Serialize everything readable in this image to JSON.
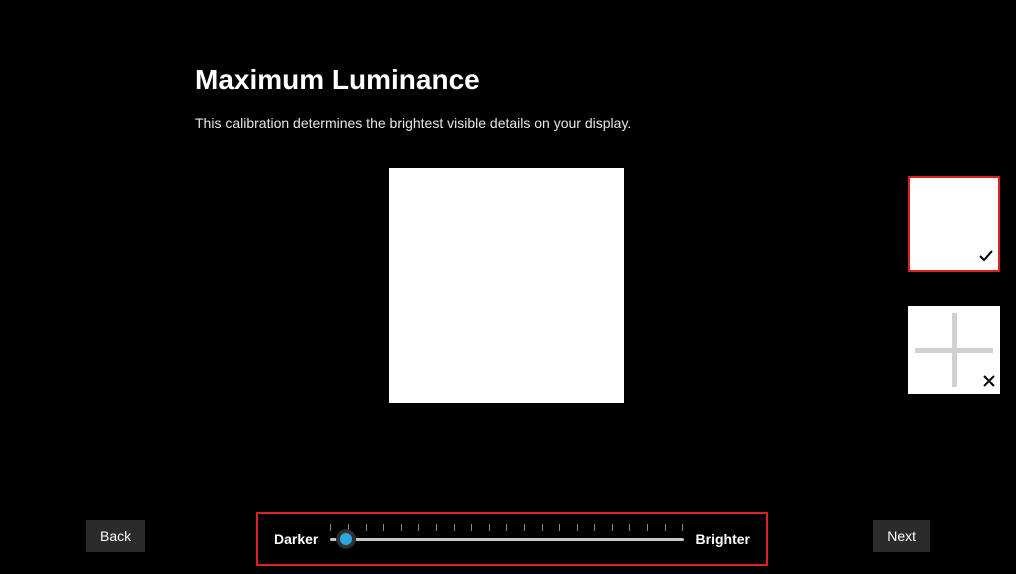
{
  "title": "Maximum Luminance",
  "subtitle": "This calibration determines the brightest visible details on your display.",
  "slider": {
    "left_label": "Darker",
    "right_label": "Brighter",
    "position_percent": 2,
    "ticks": 21
  },
  "thumbnails": {
    "selected_index": 0,
    "items": [
      {
        "kind": "solid-white",
        "mark": "check"
      },
      {
        "kind": "four-grid",
        "mark": "cross"
      }
    ]
  },
  "buttons": {
    "back": "Back",
    "next": "Next"
  }
}
